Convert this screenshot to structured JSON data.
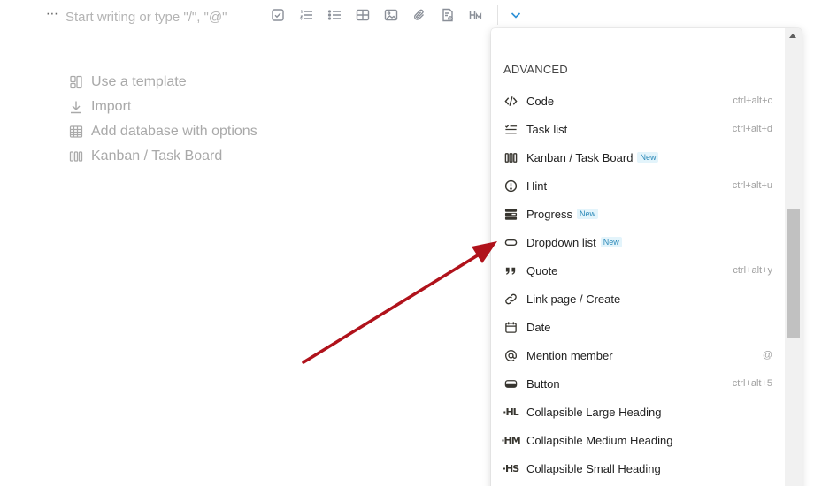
{
  "editor": {
    "drag_handle": "⋯",
    "placeholder": "Start writing or type \"/\", \"@\""
  },
  "toolbar": {
    "tools": [
      "checkbox-icon",
      "numbered-list-icon",
      "bulleted-list-icon",
      "table-icon",
      "image-icon",
      "attachment-icon",
      "page-icon",
      "heading-medium-icon"
    ],
    "expand": "chevron-down-icon"
  },
  "suggestions": [
    {
      "label": "Use a template",
      "icon": "template-icon"
    },
    {
      "label": "Import",
      "icon": "import-icon"
    },
    {
      "label": "Add database with options",
      "icon": "database-icon"
    },
    {
      "label": "Kanban / Task Board",
      "icon": "kanban-icon"
    }
  ],
  "menu": {
    "section_title": "ADVANCED",
    "items": [
      {
        "label": "Code",
        "icon": "code-icon",
        "shortcut": "ctrl+alt+c",
        "badge": ""
      },
      {
        "label": "Task list",
        "icon": "task-list-icon",
        "shortcut": "ctrl+alt+d",
        "badge": ""
      },
      {
        "label": "Kanban / Task Board",
        "icon": "kanban-icon",
        "shortcut": "",
        "badge": "New"
      },
      {
        "label": "Hint",
        "icon": "hint-icon",
        "shortcut": "ctrl+alt+u",
        "badge": ""
      },
      {
        "label": "Progress",
        "icon": "progress-icon",
        "shortcut": "",
        "badge": "New"
      },
      {
        "label": "Dropdown list",
        "icon": "dropdown-list-icon",
        "shortcut": "",
        "badge": "New"
      },
      {
        "label": "Quote",
        "icon": "quote-icon",
        "shortcut": "ctrl+alt+y",
        "badge": ""
      },
      {
        "label": "Link page / Create",
        "icon": "link-icon",
        "shortcut": "",
        "badge": ""
      },
      {
        "label": "Date",
        "icon": "calendar-icon",
        "shortcut": "",
        "badge": ""
      },
      {
        "label": "Mention member",
        "icon": "at-icon",
        "shortcut": "@",
        "badge": ""
      },
      {
        "label": "Button",
        "icon": "button-icon",
        "shortcut": "ctrl+alt+5",
        "badge": ""
      },
      {
        "label": "Collapsible Large Heading",
        "icon": "collapsible-large-heading-icon",
        "shortcut": "",
        "badge": "",
        "glyph": "·HL"
      },
      {
        "label": "Collapsible Medium Heading",
        "icon": "collapsible-medium-heading-icon",
        "shortcut": "",
        "badge": "",
        "glyph": "·HM"
      },
      {
        "label": "Collapsible Small Heading",
        "icon": "collapsible-small-heading-icon",
        "shortcut": "",
        "badge": "",
        "glyph": "·HS"
      }
    ]
  },
  "colors": {
    "annotation_arrow": "#b0121b",
    "accent": "#2a8fd6",
    "badge_text": "#2c89b8",
    "badge_bg": "#e3f4fb"
  }
}
